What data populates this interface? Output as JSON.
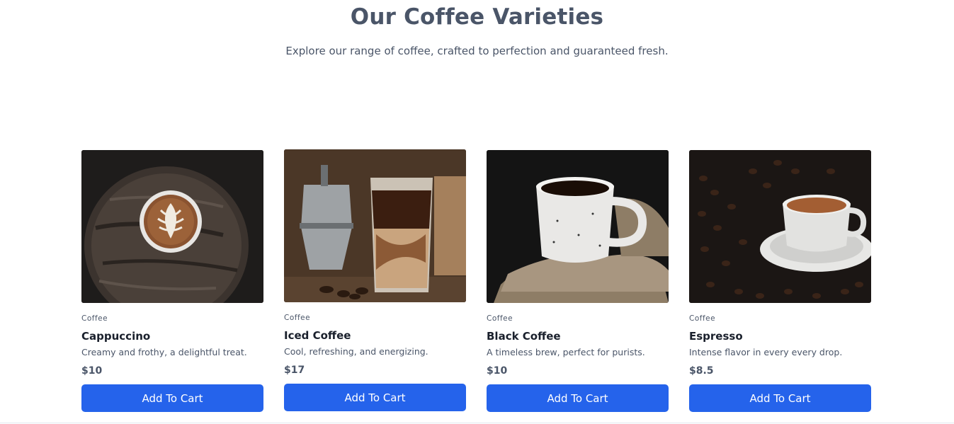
{
  "header": {
    "title": "Our Coffee Varieties",
    "subtitle": "Explore our range of coffee, crafted to perfection and guaranteed fresh."
  },
  "products": [
    {
      "category": "Coffee",
      "name": "Cappuccino",
      "description": "Creamy and frothy, a delightful treat.",
      "price": "$10",
      "button_label": "Add To Cart",
      "image": "cappuccino-latte-art-photo"
    },
    {
      "category": "Coffee",
      "name": "Iced Coffee",
      "description": "Cool, refreshing, and energizing.",
      "price": "$17",
      "button_label": "Add To Cart",
      "image": "iced-coffee-glass-photo"
    },
    {
      "category": "Coffee",
      "name": "Black Coffee",
      "description": "A timeless brew, perfect for purists.",
      "price": "$10",
      "button_label": "Add To Cart",
      "image": "black-coffee-mug-photo"
    },
    {
      "category": "Coffee",
      "name": "Espresso",
      "description": "Intense flavor in every every drop.",
      "price": "$8.5",
      "button_label": "Add To Cart",
      "image": "espresso-cup-beans-photo"
    }
  ],
  "colors": {
    "button": "#2563eb",
    "heading": "#4a5568",
    "title": "#1a202c"
  }
}
